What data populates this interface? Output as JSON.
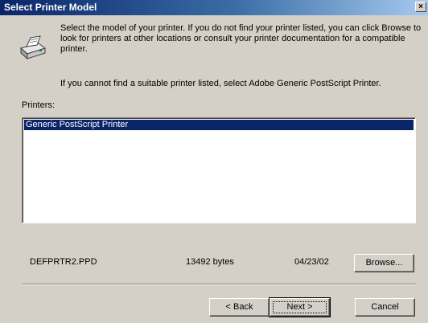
{
  "window": {
    "title": "Select Printer Model",
    "close_glyph": "×"
  },
  "description": {
    "line1": "Select the model of your printer. If you do not find your printer listed, you can click Browse to look for printers at other locations or consult your printer documentation for a compatible printer.",
    "line2": "If you cannot find a suitable printer listed, select Adobe Generic PostScript Printer."
  },
  "printers": {
    "label": "Printers:",
    "items": [
      "Generic PostScript Printer"
    ],
    "selected": "Generic PostScript Printer"
  },
  "file_info": {
    "name": "DEFPRTR2.PPD",
    "size": "13492 bytes",
    "date": "04/23/02"
  },
  "buttons": {
    "browse": "Browse...",
    "back": "< Back",
    "next": "Next >",
    "cancel": "Cancel"
  },
  "icons": {
    "header": "printer-icon"
  },
  "colors": {
    "title_bar": "#0a246a",
    "selection": "#0a246a",
    "dialog_bg": "#d4d0c8"
  }
}
